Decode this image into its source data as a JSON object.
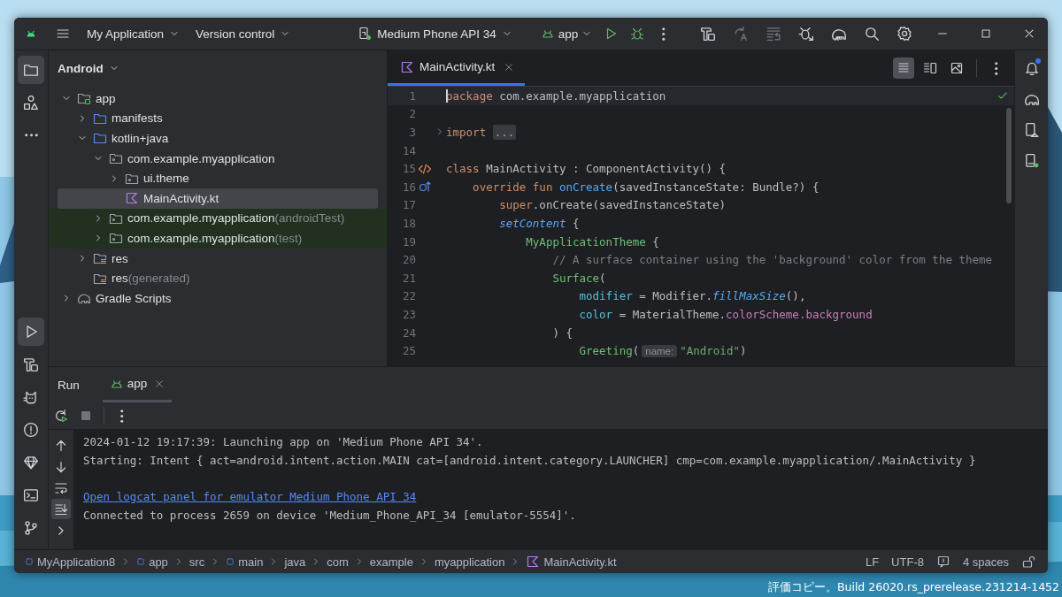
{
  "window": {
    "project_menu": "My Application",
    "vcs_menu": "Version control",
    "device_menu": "Medium Phone API 34",
    "config_menu": "app"
  },
  "toolbar": [
    {
      "kind": "build",
      "disabled": false
    },
    {
      "kind": "apply_changes",
      "disabled": true
    },
    {
      "kind": "apply_code",
      "disabled": true
    },
    {
      "kind": "attach_debugger",
      "disabled": false
    },
    {
      "kind": "profiler",
      "disabled": false
    }
  ],
  "tool_strip": {
    "top": [
      {
        "kind": "project",
        "selected": true
      },
      {
        "kind": "resources",
        "selected": false
      },
      {
        "kind": "more",
        "selected": false
      }
    ],
    "bottom": [
      {
        "kind": "run",
        "selected": true
      },
      {
        "kind": "build",
        "selected": false
      },
      {
        "kind": "logcat",
        "selected": false
      },
      {
        "kind": "problems",
        "selected": false
      },
      {
        "kind": "quality",
        "selected": false
      },
      {
        "kind": "terminal",
        "selected": false
      },
      {
        "kind": "vcs",
        "selected": false
      }
    ]
  },
  "project": {
    "view_menu": "Android",
    "tree": [
      {
        "label": "app",
        "kind": "module",
        "expanded": true,
        "selected": false,
        "test": false,
        "children": [
          {
            "label": "manifests",
            "kind": "folder",
            "expanded": false,
            "selected": false,
            "test": false
          },
          {
            "label": "kotlin+java",
            "kind": "folder",
            "expanded": true,
            "selected": false,
            "test": false,
            "children": [
              {
                "label": "com.example.myapplication",
                "kind": "package",
                "expanded": true,
                "selected": false,
                "test": false,
                "children": [
                  {
                    "label": "ui.theme",
                    "kind": "package",
                    "expanded": false,
                    "selected": false,
                    "test": false
                  },
                  {
                    "label": "MainActivity.kt",
                    "kind": "kotlin",
                    "selected": true,
                    "test": false
                  }
                ]
              },
              {
                "label": "com.example.myapplication",
                "suffix": "(androidTest)",
                "kind": "package",
                "expanded": false,
                "selected": false,
                "test": true
              },
              {
                "label": "com.example.myapplication",
                "suffix": "(test)",
                "kind": "package",
                "expanded": false,
                "selected": false,
                "test": true
              }
            ]
          },
          {
            "label": "res",
            "kind": "res",
            "expanded": false,
            "selected": false,
            "test": false
          },
          {
            "label": "res",
            "suffix": "(generated)",
            "kind": "res",
            "selected": false,
            "test": false
          }
        ]
      },
      {
        "label": "Gradle Scripts",
        "kind": "gradle",
        "expanded": false,
        "selected": false,
        "test": false
      }
    ]
  },
  "editor": {
    "tabs": [
      {
        "label": "MainActivity.kt",
        "selected": true
      }
    ],
    "view_modes": [
      {
        "kind": "code",
        "selected": true
      },
      {
        "kind": "split",
        "selected": false
      },
      {
        "kind": "design",
        "selected": false
      }
    ],
    "lines": [
      {
        "number": "1",
        "current": true,
        "tokens": [
          {
            "kind": "kw",
            "text": "package"
          },
          {
            "kind": "plain",
            "text": " com.example.myapplication"
          }
        ]
      },
      {
        "number": "2",
        "current": false
      },
      {
        "number": "3",
        "current": false,
        "gutter": {
          "kind": "fold"
        },
        "tokens": [
          {
            "kind": "kw",
            "text": "import "
          },
          {
            "kind": "fold",
            "text": "..."
          }
        ]
      },
      {
        "number": "14",
        "current": false
      },
      {
        "number": "15",
        "current": false,
        "gutter": {
          "kind": "markup"
        },
        "tokens": [
          {
            "kind": "kw",
            "text": "class"
          },
          {
            "kind": "plain",
            "text": " MainActivity : ComponentActivity() {"
          }
        ]
      },
      {
        "number": "16",
        "current": false,
        "gutter": {
          "kind": "override"
        },
        "tokens": [
          {
            "kind": "kw",
            "text": "    override fun "
          },
          {
            "kind": "fn",
            "text": "onCreate"
          },
          {
            "kind": "plain",
            "text": "(savedInstanceState: Bundle?) {"
          }
        ]
      },
      {
        "number": "17",
        "current": false,
        "tokens": [
          {
            "kind": "kw",
            "text": "        super"
          },
          {
            "kind": "plain",
            "text": ".onCreate(savedInstanceState)"
          }
        ]
      },
      {
        "number": "18",
        "current": false,
        "tokens": [
          {
            "kind": "ext",
            "text": "        setContent"
          },
          {
            "kind": "plain",
            "text": " {"
          }
        ]
      },
      {
        "number": "19",
        "current": false,
        "tokens": [
          {
            "kind": "compose",
            "text": "            MyApplicationTheme"
          },
          {
            "kind": "plain",
            "text": " {"
          }
        ]
      },
      {
        "number": "20",
        "current": false,
        "tokens": [
          {
            "kind": "comment",
            "text": "                // A surface container using the 'background' color from the theme"
          }
        ]
      },
      {
        "number": "21",
        "current": false,
        "tokens": [
          {
            "kind": "compose",
            "text": "                Surface"
          },
          {
            "kind": "plain",
            "text": "("
          }
        ]
      },
      {
        "number": "22",
        "current": false,
        "tokens": [
          {
            "kind": "param",
            "text": "                    modifier"
          },
          {
            "kind": "plain",
            "text": " = Modifier."
          },
          {
            "kind": "ext",
            "text": "fillMaxSize"
          },
          {
            "kind": "plain",
            "text": "(),"
          }
        ]
      },
      {
        "number": "23",
        "current": false,
        "tokens": [
          {
            "kind": "param",
            "text": "                    color"
          },
          {
            "kind": "plain",
            "text": " = MaterialTheme."
          },
          {
            "kind": "prop",
            "text": "colorScheme"
          },
          {
            "kind": "prop",
            "text": ".background"
          }
        ]
      },
      {
        "number": "24",
        "current": false,
        "tokens": [
          {
            "kind": "plain",
            "text": "                ) {"
          }
        ]
      },
      {
        "number": "25",
        "current": false,
        "tokens": [
          {
            "kind": "compose",
            "text": "                    Greeting"
          },
          {
            "kind": "plain",
            "text": "("
          },
          {
            "kind": "hint",
            "text": "name:"
          },
          {
            "kind": "str",
            "text": "\"Android\""
          },
          {
            "kind": "plain",
            "text": ")"
          }
        ]
      }
    ]
  },
  "run": {
    "title": "Run",
    "tabs": [
      {
        "label": "app",
        "selected": true
      }
    ],
    "side_tools": [
      {
        "kind": "up",
        "selected": false
      },
      {
        "kind": "down",
        "selected": false
      },
      {
        "kind": "wrap",
        "selected": false
      },
      {
        "kind": "scroll_end",
        "selected": true
      },
      {
        "kind": "expand",
        "selected": false
      }
    ],
    "console": [
      {
        "kind": "text",
        "text": "2024-01-12 19:17:39: Launching app on 'Medium Phone API 34'."
      },
      {
        "kind": "text",
        "text": "Starting: Intent { act=android.intent.action.MAIN cat=[android.intent.category.LAUNCHER] cmp=com.example.myapplication/.MainActivity }"
      },
      {
        "kind": "blank"
      },
      {
        "kind": "link",
        "text": "Open logcat panel for emulator Medium Phone API 34"
      },
      {
        "kind": "text",
        "text": "Connected to process 2659 on device 'Medium_Phone_API_34 [emulator-5554]'."
      }
    ]
  },
  "status_bar": {
    "breadcrumbs": [
      {
        "label": "MyApplication8",
        "kind": "module"
      },
      {
        "label": "app",
        "kind": "module"
      },
      {
        "label": "src",
        "kind": "plain"
      },
      {
        "label": "main",
        "kind": "module"
      },
      {
        "label": "java",
        "kind": "plain"
      },
      {
        "label": "com",
        "kind": "plain"
      },
      {
        "label": "example",
        "kind": "plain"
      },
      {
        "label": "myapplication",
        "kind": "plain"
      },
      {
        "label": "MainActivity.kt",
        "kind": "kotlin"
      }
    ],
    "line_separator": "LF",
    "encoding": "UTF-8",
    "indent": "4 spaces"
  },
  "desktop": {
    "watermark": "評価コピー。Build 26020.rs_prerelease.231214-1452"
  }
}
